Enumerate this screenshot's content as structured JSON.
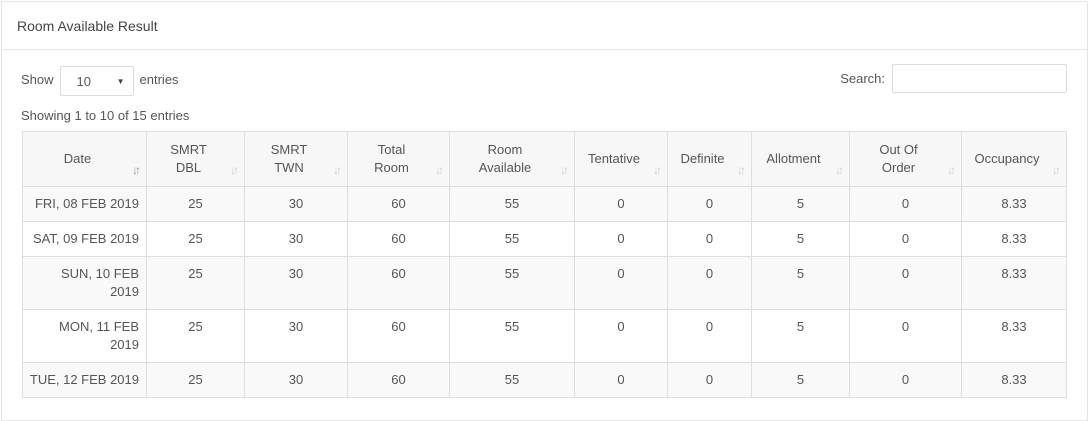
{
  "panel": {
    "title": "Room Available Result"
  },
  "length": {
    "show_label": "Show",
    "selected": "10",
    "entries_label": "entries"
  },
  "search": {
    "label": "Search:",
    "value": "",
    "placeholder": ""
  },
  "info": {
    "text": "Showing 1 to 10 of 15 entries"
  },
  "table": {
    "columns": [
      {
        "line1": "Date",
        "line2": ""
      },
      {
        "line1": "SMRT",
        "line2": "DBL"
      },
      {
        "line1": "SMRT",
        "line2": "TWN"
      },
      {
        "line1": "Total",
        "line2": "Room"
      },
      {
        "line1": "Room",
        "line2": "Available"
      },
      {
        "line1": "Tentative",
        "line2": ""
      },
      {
        "line1": "Definite",
        "line2": ""
      },
      {
        "line1": "Allotment",
        "line2": ""
      },
      {
        "line1": "Out Of",
        "line2": "Order"
      },
      {
        "line1": "Occupancy",
        "line2": ""
      }
    ],
    "rows": [
      [
        "FRI, 08 FEB 2019",
        "25",
        "30",
        "60",
        "55",
        "0",
        "0",
        "5",
        "0",
        "8.33"
      ],
      [
        "SAT, 09 FEB 2019",
        "25",
        "30",
        "60",
        "55",
        "0",
        "0",
        "5",
        "0",
        "8.33"
      ],
      [
        "SUN, 10 FEB 2019",
        "25",
        "30",
        "60",
        "55",
        "0",
        "0",
        "5",
        "0",
        "8.33"
      ],
      [
        "MON, 11 FEB 2019",
        "25",
        "30",
        "60",
        "55",
        "0",
        "0",
        "5",
        "0",
        "8.33"
      ],
      [
        "TUE, 12 FEB 2019",
        "25",
        "30",
        "60",
        "55",
        "0",
        "0",
        "5",
        "0",
        "8.33"
      ]
    ]
  },
  "icons": {
    "sort": "sort-icon",
    "sort_asc": "sort-ascending-icon",
    "caret": "chevron-down-icon"
  },
  "colors": {
    "header_bg": "#f7f7f7",
    "row_alt_bg": "#f9f9f9",
    "border": "#dedede"
  }
}
